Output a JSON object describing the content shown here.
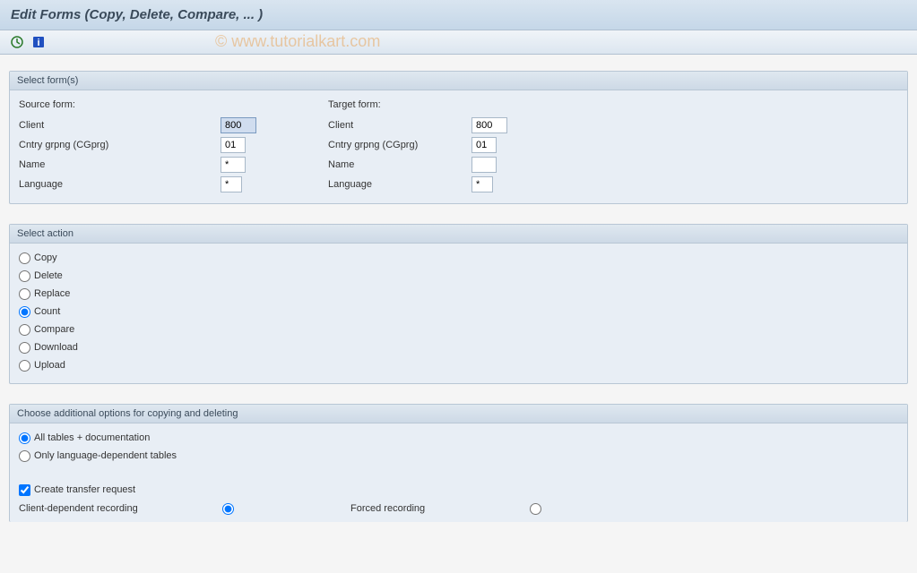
{
  "title": "Edit Forms (Copy, Delete, Compare, ... )",
  "watermark": "© www.tutorialkart.com",
  "groups": {
    "selectForms": {
      "title": "Select form(s)",
      "source": {
        "header": "Source form:",
        "client": {
          "label": "Client",
          "value": "800"
        },
        "cgprg": {
          "label": "Cntry grpng (CGprg)",
          "value": "01"
        },
        "name": {
          "label": "Name",
          "value": "*"
        },
        "language": {
          "label": "Language",
          "value": "*"
        }
      },
      "target": {
        "header": "Target form:",
        "client": {
          "label": "Client",
          "value": "800"
        },
        "cgprg": {
          "label": "Cntry grpng (CGprg)",
          "value": "01"
        },
        "name": {
          "label": "Name",
          "value": ""
        },
        "language": {
          "label": "Language",
          "value": "*"
        }
      }
    },
    "selectAction": {
      "title": "Select action",
      "options": {
        "copy": "Copy",
        "delete": "Delete",
        "replace": "Replace",
        "count": "Count",
        "compare": "Compare",
        "download": "Download",
        "upload": "Upload"
      },
      "selected": "count"
    },
    "additionalOptions": {
      "title": "Choose additional options for copying and deleting",
      "scope": {
        "all": "All tables + documentation",
        "lang": "Only language-dependent tables"
      },
      "scopeSelected": "all",
      "transferRequest": "Create transfer request",
      "recording": {
        "clientDependent": "Client-dependent recording",
        "forced": "Forced recording"
      },
      "recordingSelected": "clientDependent"
    }
  }
}
